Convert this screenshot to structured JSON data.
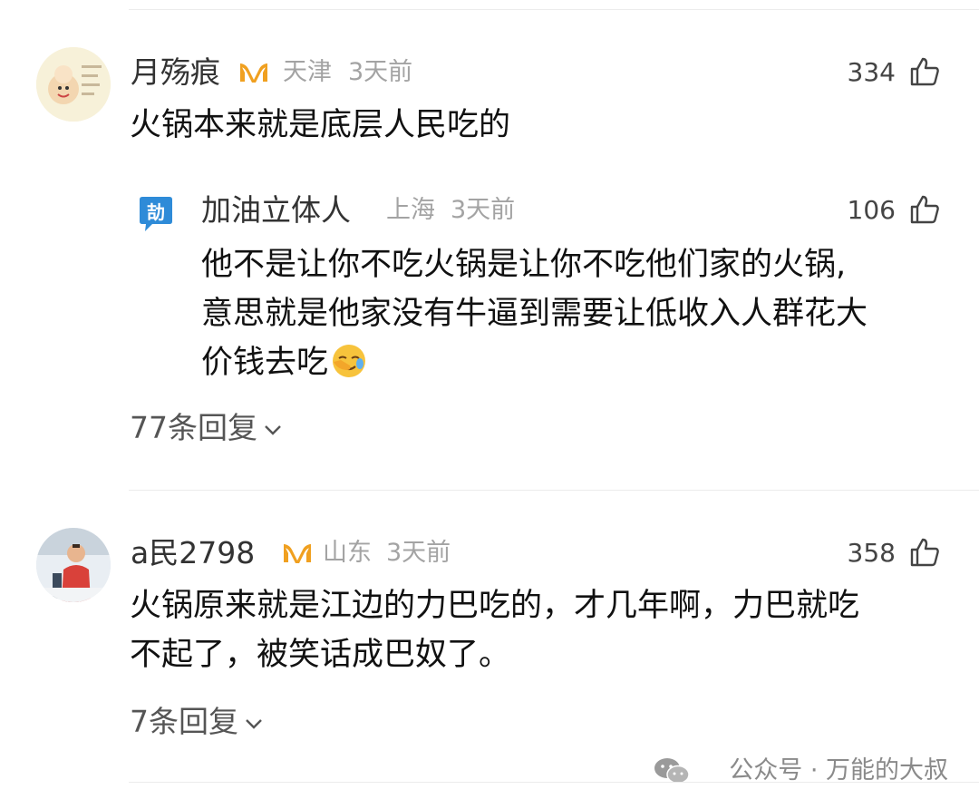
{
  "comments": [
    {
      "user": "月殇痕",
      "location": "天津",
      "time": "3天前",
      "likes": "334",
      "text": "火锅本来就是底层人民吃的",
      "badge_icon": "vip-badge-icon",
      "reply_preview": {
        "user": "加油立体人",
        "location": "上海",
        "time": "3天前",
        "likes": "106",
        "lines": [
          "他不是让你不吃火锅是让你不吃他们家的火锅,",
          "意思就是他家没有牛逼到需要让低收入人群花大",
          "价钱去吃"
        ],
        "emoji_icon": "facepalm-emoji-icon"
      },
      "replies_label": "77条回复"
    },
    {
      "user": "a民2798",
      "location": "山东",
      "time": "3天前",
      "likes": "358",
      "lines": [
        "火锅原来就是江边的力巴吃的，才几年啊，力巴就吃",
        "不起了，被笑话成巴奴了。"
      ],
      "badge_icon": "vip-badge-icon",
      "replies_label": "7条回复"
    }
  ],
  "watermark": "公众号 · 万能的大叔",
  "colors": {
    "badge": "#f0a020",
    "meta": "#a3a3a3",
    "divider": "#ececec",
    "reply_avatar": "#2e8bd8"
  }
}
